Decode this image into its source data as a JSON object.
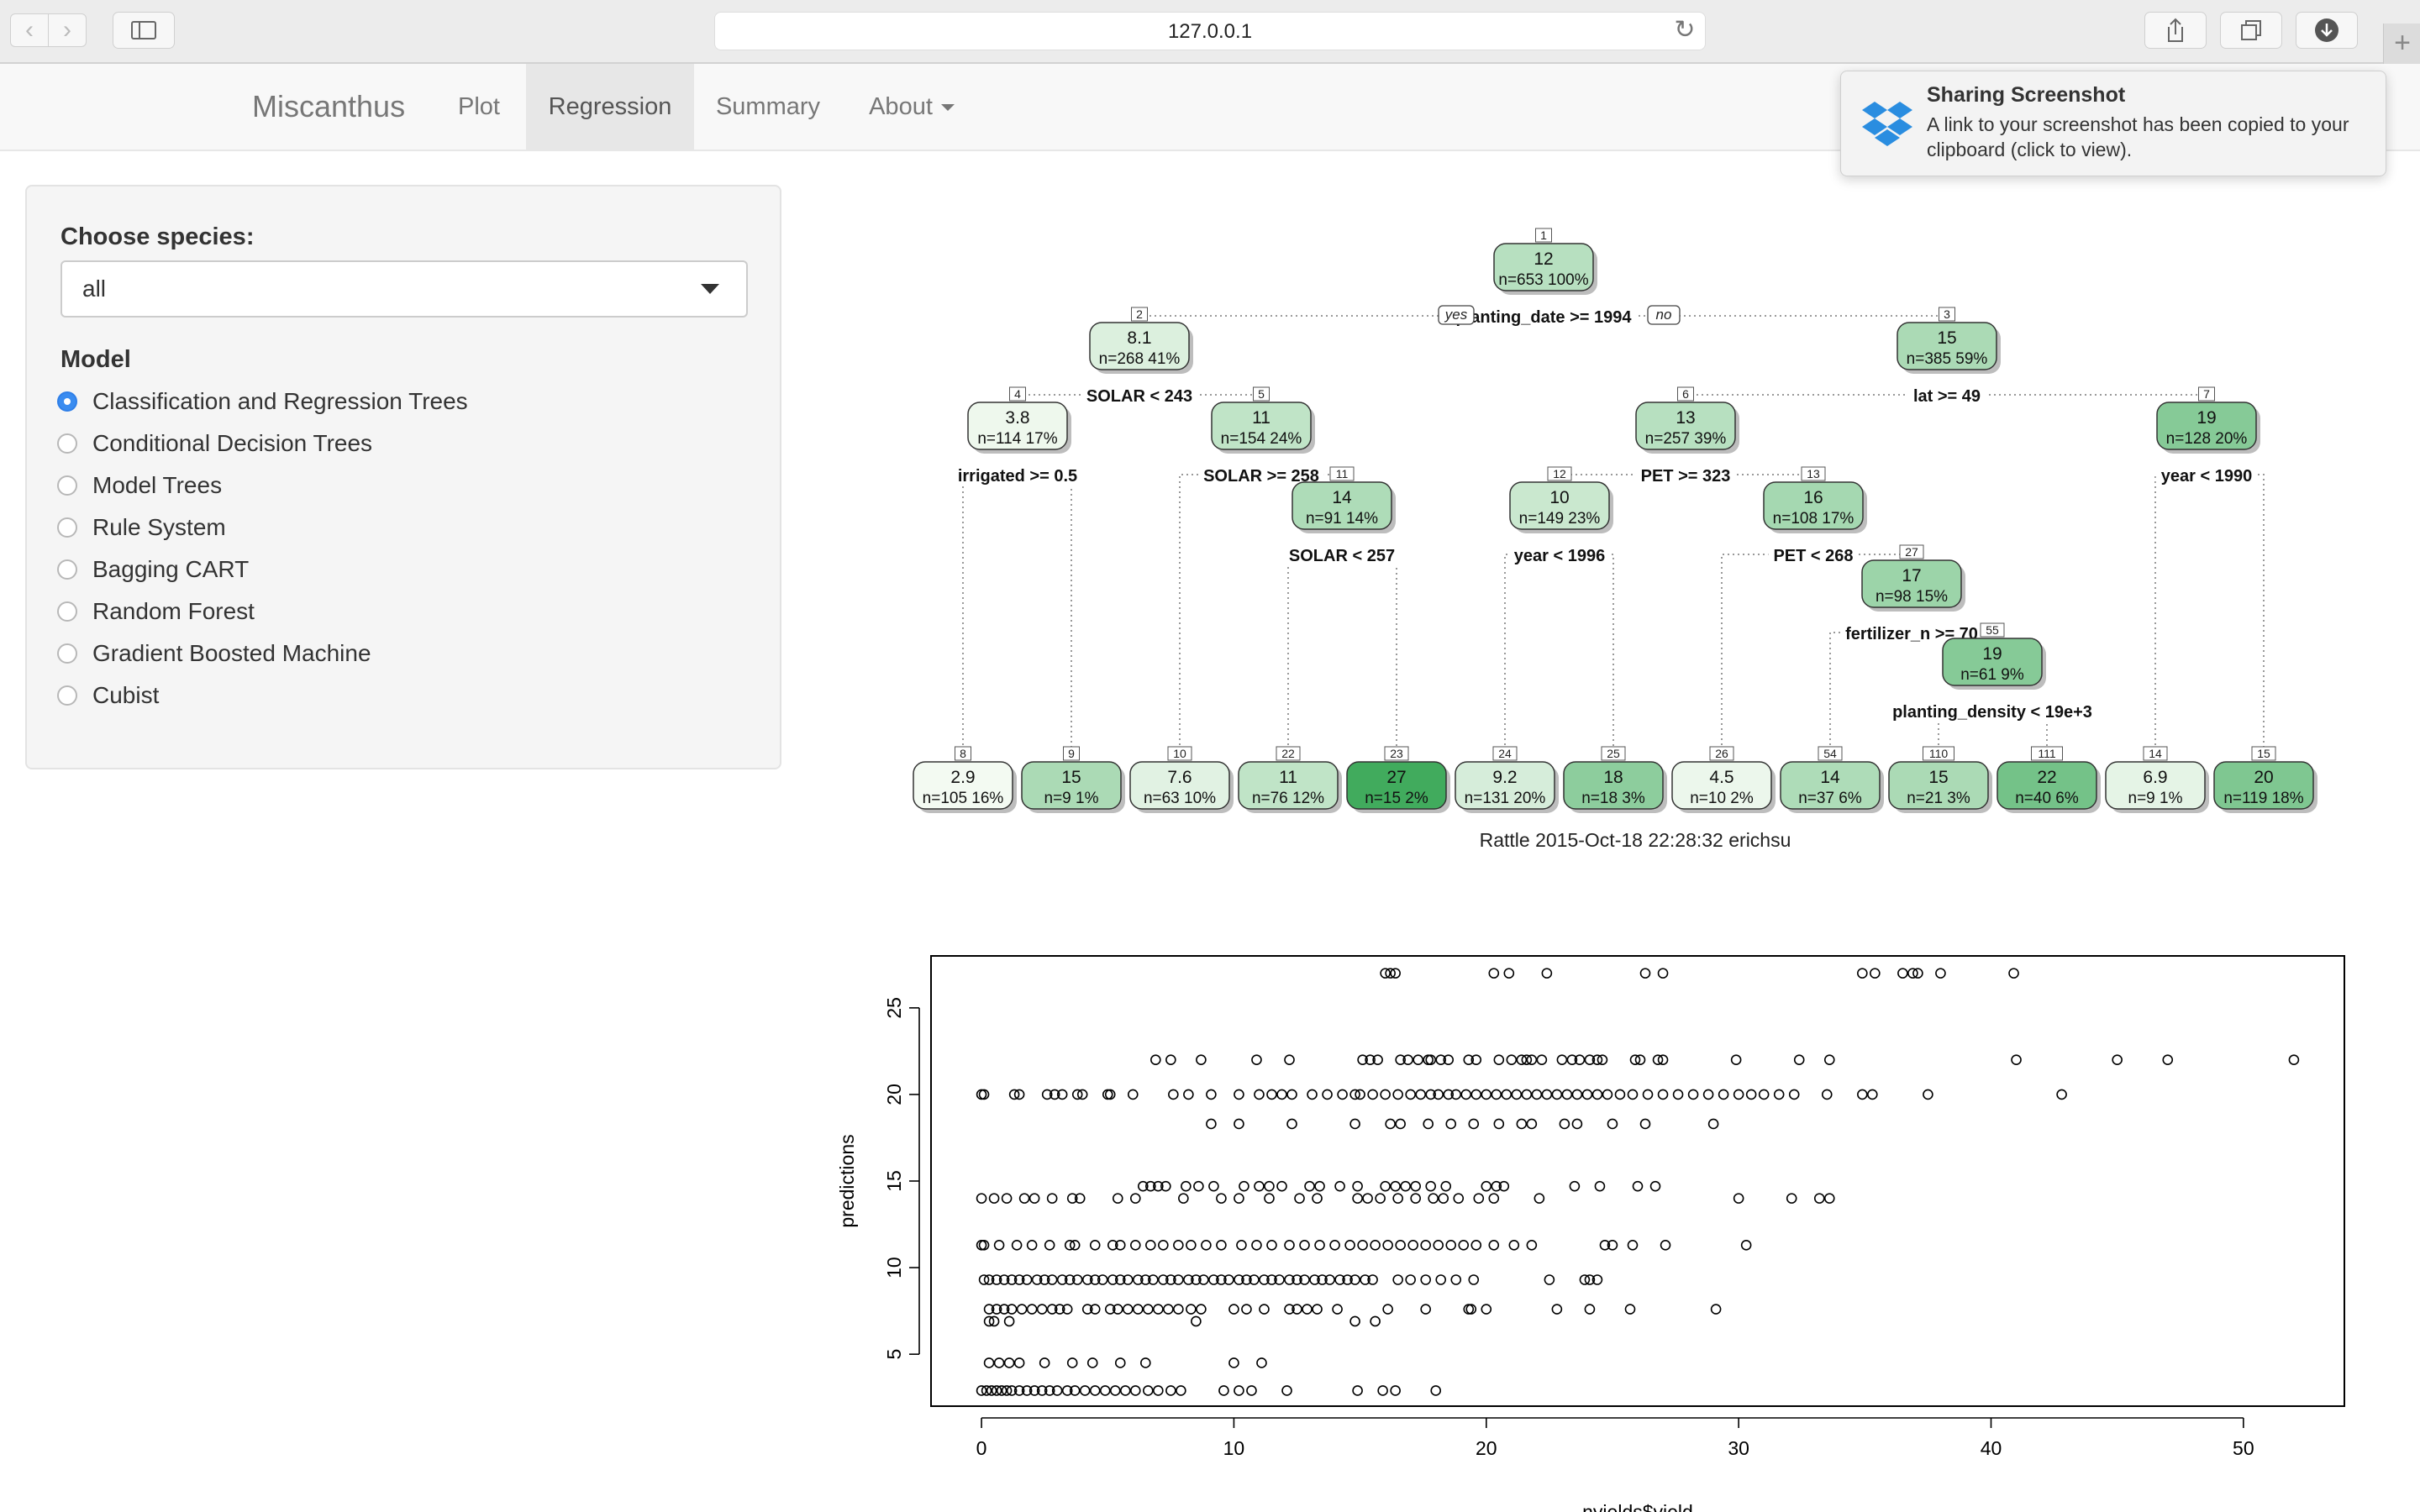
{
  "browser": {
    "url": "127.0.0.1",
    "back_icon": "chevron-left-icon",
    "forward_icon": "chevron-right-icon"
  },
  "navbar": {
    "brand": "Miscanthus",
    "items": [
      {
        "label": "Plot",
        "active": false
      },
      {
        "label": "Regression",
        "active": true
      },
      {
        "label": "Summary",
        "active": false
      },
      {
        "label": "About",
        "active": false,
        "dropdown": true
      }
    ]
  },
  "notification": {
    "title": "Sharing Screenshot",
    "body": "A link to your screenshot has been copied to your clipboard (click to view)."
  },
  "sidebar": {
    "species_label": "Choose species:",
    "species_value": "all",
    "model_label": "Model",
    "models": [
      {
        "label": "Classification and Regression Trees",
        "checked": true
      },
      {
        "label": "Conditional Decision Trees",
        "checked": false
      },
      {
        "label": "Model Trees",
        "checked": false
      },
      {
        "label": "Rule System",
        "checked": false
      },
      {
        "label": "Bagging CART",
        "checked": false
      },
      {
        "label": "Random Forest",
        "checked": false
      },
      {
        "label": "Gradient Boosted Machine",
        "checked": false
      },
      {
        "label": "Cubist",
        "checked": false
      }
    ]
  },
  "tree": {
    "caption": "Rattle 2015-Oct-18 22:28:32 erichsu",
    "yes_label": "yes",
    "no_label": "no",
    "nodes": [
      {
        "id": "1",
        "value": "12",
        "n": "n=653  100%",
        "shade": 0.35
      },
      {
        "id": "2",
        "value": "8.1",
        "n": "n=268  41%",
        "shade": 0.15
      },
      {
        "id": "3",
        "value": "15",
        "n": "n=385  59%",
        "shade": 0.42
      },
      {
        "id": "4",
        "value": "3.8",
        "n": "n=114  17%",
        "shade": 0.05
      },
      {
        "id": "5",
        "value": "11",
        "n": "n=154  24%",
        "shade": 0.3
      },
      {
        "id": "6",
        "value": "13",
        "n": "n=257  39%",
        "shade": 0.35
      },
      {
        "id": "7",
        "value": "19",
        "n": "n=128  20%",
        "shade": 0.62
      },
      {
        "id": "11",
        "value": "14",
        "n": "n=91  14%",
        "shade": 0.4
      },
      {
        "id": "12",
        "value": "10",
        "n": "n=149  23%",
        "shade": 0.25
      },
      {
        "id": "13",
        "value": "16",
        "n": "n=108  17%",
        "shade": 0.45
      },
      {
        "id": "27",
        "value": "17",
        "n": "n=98  15%",
        "shade": 0.5
      },
      {
        "id": "55",
        "value": "19",
        "n": "n=61  9%",
        "shade": 0.62
      },
      {
        "id": "8",
        "value": "2.9",
        "n": "n=105  16%",
        "shade": 0.02
      },
      {
        "id": "9",
        "value": "15",
        "n": "n=9  1%",
        "shade": 0.42
      },
      {
        "id": "10",
        "value": "7.6",
        "n": "n=63  10%",
        "shade": 0.12
      },
      {
        "id": "22",
        "value": "11",
        "n": "n=76  12%",
        "shade": 0.3
      },
      {
        "id": "23",
        "value": "27",
        "n": "n=15  2%",
        "shade": 1.0
      },
      {
        "id": "24",
        "value": "9.2",
        "n": "n=131  20%",
        "shade": 0.18
      },
      {
        "id": "25",
        "value": "18",
        "n": "n=18  3%",
        "shade": 0.58
      },
      {
        "id": "26",
        "value": "4.5",
        "n": "n=10  2%",
        "shade": 0.06
      },
      {
        "id": "54",
        "value": "14",
        "n": "n=37  6%",
        "shade": 0.4
      },
      {
        "id": "110",
        "value": "15",
        "n": "n=21  3%",
        "shade": 0.42
      },
      {
        "id": "111",
        "value": "22",
        "n": "n=40  6%",
        "shade": 0.72
      },
      {
        "id": "14",
        "value": "6.9",
        "n": "n=9  1%",
        "shade": 0.1
      },
      {
        "id": "15",
        "value": "20",
        "n": "n=119  18%",
        "shade": 0.66
      }
    ],
    "splits": [
      {
        "node": "1",
        "label": "planting_date >= 1994"
      },
      {
        "node": "2",
        "label": "SOLAR < 243"
      },
      {
        "node": "3",
        "label": "lat >= 49"
      },
      {
        "node": "4",
        "label": "irrigated >= 0.5"
      },
      {
        "node": "5",
        "label": "SOLAR >= 258"
      },
      {
        "node": "6",
        "label": "PET >= 323"
      },
      {
        "node": "7",
        "label": "year < 1990"
      },
      {
        "node": "11",
        "label": "SOLAR < 257"
      },
      {
        "node": "12",
        "label": "year < 1996"
      },
      {
        "node": "13",
        "label": "PET < 268"
      },
      {
        "node": "27",
        "label": "fertilizer_n >= 70"
      },
      {
        "node": "55",
        "label": "planting_density < 19e+3"
      }
    ]
  },
  "chart_data": {
    "type": "scatter",
    "xlabel": "nyields$yield",
    "ylabel": "predictions",
    "xlim": [
      -2,
      54
    ],
    "ylim": [
      2,
      28
    ],
    "xticks": [
      0,
      10,
      20,
      30,
      40,
      50
    ],
    "yticks": [
      5,
      10,
      15,
      20,
      25
    ],
    "levels": [
      {
        "y": 27.0,
        "x": [
          16.0,
          16.2,
          16.4,
          20.3,
          20.9,
          22.4,
          26.3,
          27.0,
          34.9,
          35.4,
          36.5,
          36.9,
          37.1,
          38.0,
          40.9
        ]
      },
      {
        "y": 22.0,
        "x": [
          6.9,
          7.5,
          8.7,
          10.9,
          12.2,
          15.1,
          15.4,
          15.7,
          16.6,
          16.9,
          17.3,
          17.7,
          17.8,
          18.2,
          18.5,
          19.3,
          19.6,
          20.5,
          21.0,
          21.4,
          21.6,
          21.8,
          22.2,
          23.0,
          23.4,
          23.7,
          24.1,
          24.4,
          24.6,
          25.9,
          26.1,
          26.8,
          27.0,
          29.9,
          32.4,
          33.6,
          41.0,
          45.0,
          47.0,
          52.0
        ]
      },
      {
        "y": 20.0,
        "x": [
          0.0,
          0.1,
          1.3,
          1.5,
          2.6,
          2.9,
          3.2,
          3.8,
          4.0,
          5.0,
          5.1,
          6.0,
          7.6,
          8.2,
          9.1,
          10.2,
          11.0,
          11.5,
          11.9,
          12.3,
          13.1,
          13.7,
          14.3,
          14.8,
          15.0,
          15.5,
          16.0,
          16.5,
          17.0,
          17.4,
          17.8,
          18.1,
          18.5,
          18.8,
          19.2,
          19.6,
          20.0,
          20.4,
          20.8,
          21.2,
          21.6,
          22.0,
          22.4,
          22.8,
          23.2,
          23.6,
          24.0,
          24.4,
          24.8,
          25.3,
          25.8,
          26.4,
          27.0,
          27.6,
          28.2,
          28.8,
          29.4,
          30.0,
          30.5,
          31.0,
          31.6,
          32.2,
          33.5,
          34.9,
          35.3,
          37.5,
          42.8
        ]
      },
      {
        "y": 18.3,
        "x": [
          9.1,
          10.2,
          12.3,
          14.8,
          16.2,
          16.6,
          17.7,
          18.6,
          19.5,
          20.5,
          21.4,
          21.8,
          23.1,
          23.6,
          25.0,
          26.3,
          29.0
        ]
      },
      {
        "y": 14.7,
        "x": [
          6.4,
          6.7,
          7.0,
          7.3,
          8.1,
          8.6,
          9.2,
          10.4,
          11.0,
          11.4,
          11.9,
          13.0,
          13.4,
          14.2,
          14.9,
          16.0,
          16.4,
          16.8,
          17.2,
          17.8,
          18.4,
          20.0,
          20.4,
          20.7,
          23.5,
          24.5,
          26.0,
          26.7
        ]
      },
      {
        "y": 14.0,
        "x": [
          0.0,
          0.5,
          1.0,
          1.7,
          2.1,
          2.8,
          3.6,
          3.9,
          5.4,
          6.1,
          8.0,
          9.5,
          10.2,
          11.4,
          12.6,
          13.3,
          14.9,
          15.3,
          15.8,
          16.5,
          17.2,
          17.9,
          18.3,
          18.9,
          19.7,
          20.3,
          22.1,
          30.0,
          32.1,
          33.2,
          33.6
        ]
      },
      {
        "y": 11.3,
        "x": [
          0.0,
          0.1,
          0.7,
          1.4,
          2.0,
          2.7,
          3.5,
          3.7,
          4.5,
          5.2,
          5.5,
          6.1,
          6.7,
          7.2,
          7.8,
          8.3,
          8.9,
          9.5,
          10.3,
          10.9,
          11.5,
          12.2,
          12.8,
          13.4,
          14.0,
          14.6,
          15.1,
          15.6,
          16.1,
          16.6,
          17.1,
          17.6,
          18.1,
          18.6,
          19.1,
          19.6,
          20.3,
          21.1,
          21.8,
          24.7,
          25.0,
          25.8,
          27.1,
          30.3
        ]
      },
      {
        "y": 9.3,
        "x": [
          0.1,
          0.3,
          0.6,
          0.9,
          1.2,
          1.5,
          1.8,
          2.2,
          2.5,
          2.8,
          3.2,
          3.5,
          3.8,
          4.2,
          4.5,
          4.8,
          5.2,
          5.5,
          5.8,
          6.2,
          6.5,
          6.8,
          7.2,
          7.5,
          7.8,
          8.2,
          8.5,
          8.8,
          9.2,
          9.5,
          9.8,
          10.2,
          10.5,
          10.8,
          11.2,
          11.5,
          11.8,
          12.2,
          12.5,
          12.8,
          13.2,
          13.5,
          13.8,
          14.2,
          14.5,
          14.8,
          15.2,
          15.5,
          16.5,
          17.0,
          17.6,
          18.2,
          18.8,
          19.5,
          22.5,
          23.9,
          24.1,
          24.4
        ]
      },
      {
        "y": 7.6,
        "x": [
          0.3,
          0.6,
          0.9,
          1.2,
          1.6,
          2.0,
          2.4,
          2.8,
          3.1,
          3.4,
          4.2,
          4.5,
          5.1,
          5.4,
          5.8,
          6.2,
          6.6,
          7.0,
          7.4,
          7.8,
          8.3,
          8.7,
          10.0,
          10.5,
          11.2,
          12.2,
          12.5,
          12.9,
          13.3,
          14.1,
          16.1,
          17.6,
          19.3,
          19.4,
          20.0,
          22.8,
          24.1,
          25.7,
          29.1
        ]
      },
      {
        "y": 6.9,
        "x": [
          0.3,
          0.5,
          1.1,
          8.5,
          14.8,
          15.6
        ]
      },
      {
        "y": 4.5,
        "x": [
          0.3,
          0.7,
          1.1,
          1.5,
          2.5,
          3.6,
          4.4,
          5.5,
          6.5,
          10.0,
          11.1
        ]
      },
      {
        "y": 2.9,
        "x": [
          0.0,
          0.2,
          0.4,
          0.6,
          0.8,
          1.0,
          1.2,
          1.5,
          1.8,
          2.1,
          2.4,
          2.7,
          3.0,
          3.4,
          3.7,
          4.1,
          4.5,
          4.9,
          5.3,
          5.7,
          6.1,
          6.6,
          7.0,
          7.5,
          7.9,
          9.6,
          10.2,
          10.7,
          12.1,
          14.9,
          15.9,
          16.4,
          18.0
        ]
      }
    ]
  }
}
